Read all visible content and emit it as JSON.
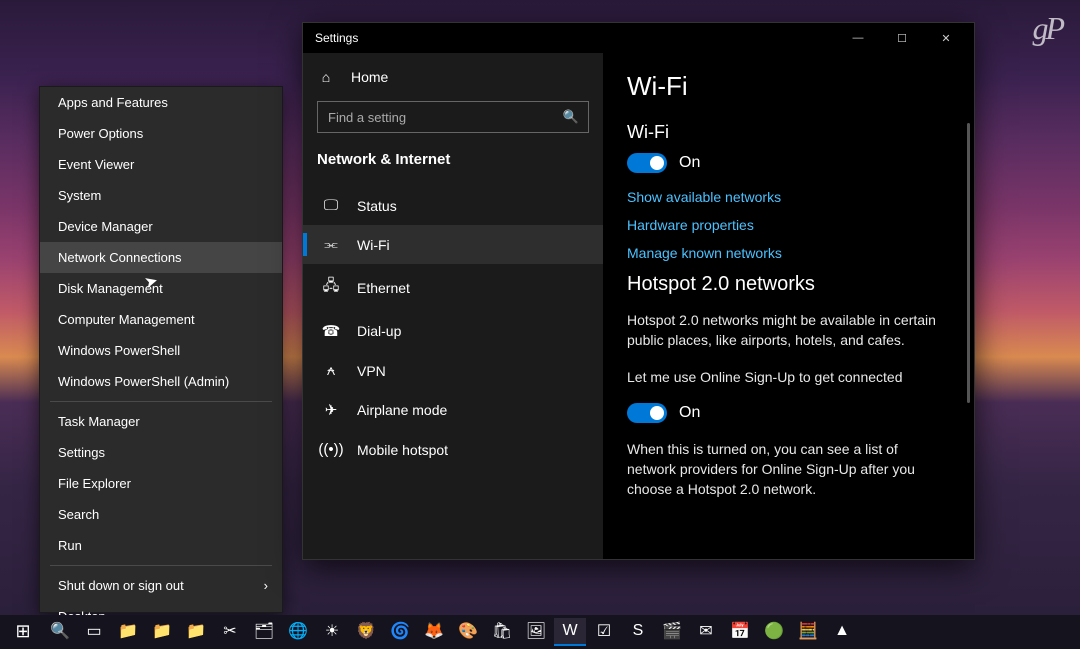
{
  "watermark": "gP",
  "winx": {
    "group1": [
      "Apps and Features",
      "Power Options",
      "Event Viewer",
      "System",
      "Device Manager",
      "Network Connections",
      "Disk Management",
      "Computer Management",
      "Windows PowerShell",
      "Windows PowerShell (Admin)"
    ],
    "group2": [
      "Task Manager",
      "Settings",
      "File Explorer",
      "Search",
      "Run"
    ],
    "group3": [
      "Shut down or sign out",
      "Desktop"
    ],
    "highlight_index": 5
  },
  "settings": {
    "title": "Settings",
    "window_controls": {
      "min": "—",
      "max": "☐",
      "close": "✕"
    },
    "nav": {
      "home": "Home",
      "search_placeholder": "Find a setting",
      "heading": "Network & Internet",
      "items": [
        {
          "icon": "status-icon",
          "glyph": "🖵",
          "label": "Status"
        },
        {
          "icon": "wifi-icon",
          "glyph": "⫘",
          "label": "Wi-Fi",
          "active": true
        },
        {
          "icon": "ethernet-icon",
          "glyph": "🖧",
          "label": "Ethernet"
        },
        {
          "icon": "dialup-icon",
          "glyph": "☎",
          "label": "Dial-up"
        },
        {
          "icon": "vpn-icon",
          "glyph": "⍲",
          "label": "VPN"
        },
        {
          "icon": "airplane-icon",
          "glyph": "✈",
          "label": "Airplane mode"
        },
        {
          "icon": "hotspot-icon",
          "glyph": "((•))",
          "label": "Mobile hotspot"
        }
      ]
    },
    "content": {
      "page_title": "Wi-Fi",
      "wifi_section": {
        "heading": "Wi-Fi",
        "toggle_state": "On"
      },
      "links": [
        "Show available networks",
        "Hardware properties",
        "Manage known networks"
      ],
      "hotspot": {
        "heading": "Hotspot 2.0 networks",
        "desc": "Hotspot 2.0 networks might be available in certain public places, like airports, hotels, and cafes.",
        "toggle_label": "Let me use Online Sign-Up to get connected",
        "toggle_state": "On",
        "desc2": "When this is turned on, you can see a list of network providers for Online Sign-Up after you choose a Hotspot 2.0 network."
      }
    }
  },
  "taskbar": {
    "items": [
      {
        "name": "start",
        "glyph": "⊞"
      },
      {
        "name": "search",
        "glyph": "🔍"
      },
      {
        "name": "taskview",
        "glyph": "▭"
      },
      {
        "name": "folder1",
        "glyph": "📁"
      },
      {
        "name": "folder2",
        "glyph": "📁"
      },
      {
        "name": "folder3",
        "glyph": "📁"
      },
      {
        "name": "snip",
        "glyph": "✂"
      },
      {
        "name": "explorer",
        "glyph": "🗂"
      },
      {
        "name": "chrome",
        "glyph": "🌐"
      },
      {
        "name": "brightness",
        "glyph": "☀"
      },
      {
        "name": "brave",
        "glyph": "🦁"
      },
      {
        "name": "edge",
        "glyph": "🌀"
      },
      {
        "name": "firefox",
        "glyph": "🦊"
      },
      {
        "name": "app1",
        "glyph": "🎨"
      },
      {
        "name": "store",
        "glyph": "🛍"
      },
      {
        "name": "photos",
        "glyph": "🖼"
      },
      {
        "name": "word",
        "glyph": "W",
        "active": true
      },
      {
        "name": "todo",
        "glyph": "☑"
      },
      {
        "name": "sway",
        "glyph": "S"
      },
      {
        "name": "movies",
        "glyph": "🎬"
      },
      {
        "name": "mail",
        "glyph": "✉"
      },
      {
        "name": "calendar",
        "glyph": "📅"
      },
      {
        "name": "vpnstatus",
        "glyph": "🟢"
      },
      {
        "name": "calc",
        "glyph": "🧮"
      },
      {
        "name": "vlc",
        "glyph": "▲"
      }
    ]
  }
}
